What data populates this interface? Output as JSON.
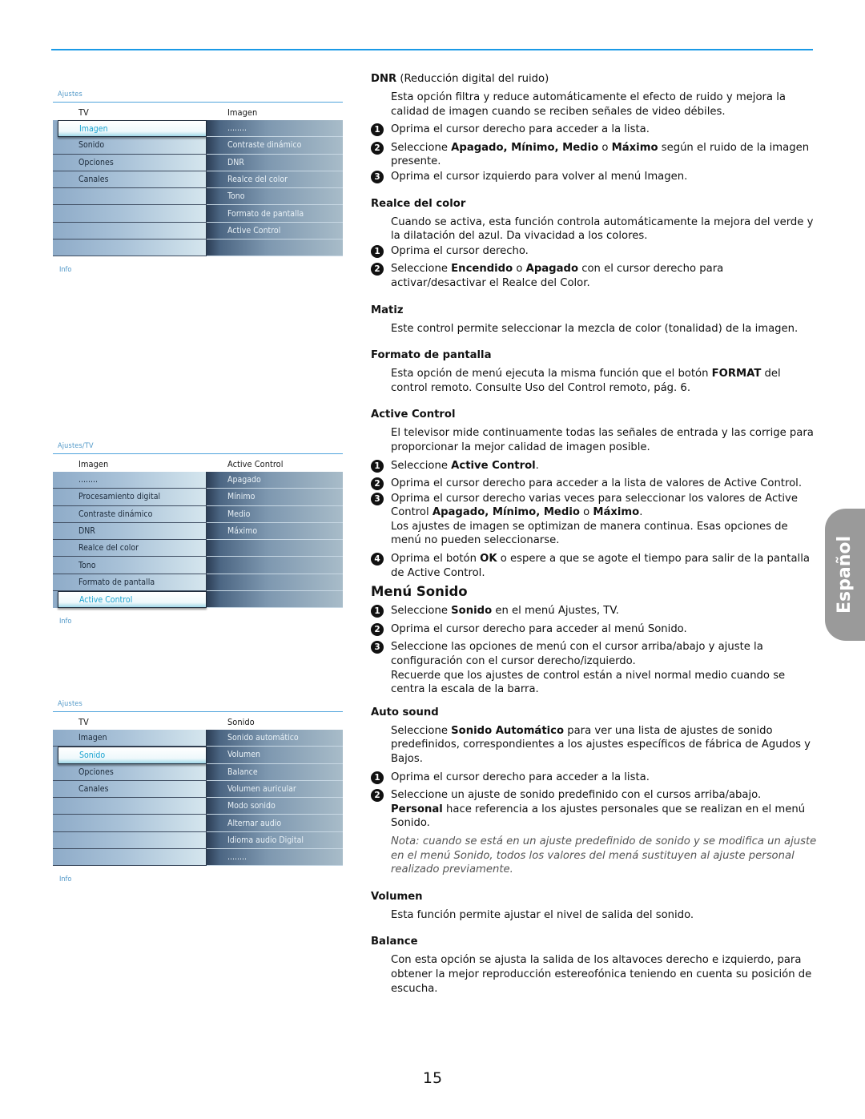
{
  "language_tab": "Español",
  "page_number": "15",
  "menus": [
    {
      "breadcrumb": "Ajustes",
      "left_header": "TV",
      "right_header": "Imagen",
      "left_items": [
        "Imagen",
        "Sonido",
        "Opciones",
        "Canales",
        "",
        "",
        "",
        ""
      ],
      "selected_index": 0,
      "right_items": [
        "........",
        "Contraste dinámico",
        "DNR",
        "Realce del color",
        "Tono",
        "Formato de pantalla",
        "Active Control",
        ""
      ],
      "info": "Info"
    },
    {
      "breadcrumb": "Ajustes/TV",
      "left_header": "Imagen",
      "right_header": "Active Control",
      "left_items": [
        "........",
        "Procesamiento digital",
        "Contraste dinámico",
        "DNR",
        "Realce del color",
        "Tono",
        "Formato de pantalla",
        "Active Control"
      ],
      "selected_index": 7,
      "right_items": [
        "Apagado",
        "Mínimo",
        "Medio",
        "Máximo",
        "",
        "",
        "",
        ""
      ],
      "info": "Info"
    },
    {
      "breadcrumb": "Ajustes",
      "left_header": "TV",
      "right_header": "Sonido",
      "left_items": [
        "Imagen",
        "Sonido",
        "Opciones",
        "Canales",
        "",
        "",
        "",
        ""
      ],
      "selected_index": 1,
      "right_items": [
        "Sonido automático",
        "Volumen",
        "Balance",
        "Volumen auricular",
        "Modo sonido",
        "Alternar audio",
        "Idioma audio Digital",
        "........"
      ],
      "info": "Info"
    }
  ],
  "sections": {
    "dnr": {
      "title": "DNR",
      "title_suffix": " (Reducción digital del ruido)",
      "body": "Esta opción filtra y reduce automáticamente el efecto de ruido y mejora la calidad de imagen cuando se reciben señales de video débiles.",
      "step1": "Oprima el cursor derecho para acceder a la lista.",
      "step2_a": "Seleccione ",
      "step2_b": "Apagado, Mínimo, Medio",
      "step2_c": " o ",
      "step2_d": "Máximo",
      "step2_e": " según el ruido de la imagen presente.",
      "step3": "Oprima el cursor izquierdo para volver al menú Imagen."
    },
    "realce": {
      "title": "Realce del color",
      "body": "Cuando se activa, esta función controla automáticamente la mejora del verde y la dilatación del azul.  Da vivacidad a los colores.",
      "step1": "Oprima el cursor derecho.",
      "step2_a": "Seleccione ",
      "step2_b": "Encendido",
      "step2_c": " o ",
      "step2_d": "Apagado",
      "step2_e": " con el cursor derecho para activar/desactivar el Realce del Color."
    },
    "matiz": {
      "title": "Matiz",
      "body": "Este control permite seleccionar la mezcla de color (tonalidad) de la imagen."
    },
    "formato": {
      "title": "Formato de pantalla",
      "body_a": "Esta opción de menú ejecuta la misma función que el botón ",
      "body_b": "FORMAT",
      "body_c": " del control remoto. Consulte Uso del Control remoto, pág. 6."
    },
    "active": {
      "title": "Active Control",
      "body": "El televisor mide continuamente todas las señales de entrada y las corrige para proporcionar la mejor calidad de imagen posible.",
      "step1_a": "Seleccione ",
      "step1_b": "Active Control",
      "step1_c": ".",
      "step2": "Oprima el cursor derecho para acceder a la lista de valores de Active Control.",
      "step3_a": "Oprima el cursor derecho varias veces para seleccionar los valores de Active Control ",
      "step3_b": "Apagado, Mínimo, Medio",
      "step3_c": " o ",
      "step3_d": "Máximo",
      "step3_e": ".",
      "step3_note": "Los ajustes de imagen se optimizan de manera continua. Esas opciones de menú no pueden seleccionarse.",
      "step4_a": "Oprima el botón ",
      "step4_b": "OK",
      "step4_c": " o espere a que se agote el tiempo para salir de la pantalla de Active Control."
    },
    "menu_sonido": {
      "title": "Menú Sonido",
      "step1_a": "Seleccione ",
      "step1_b": "Sonido",
      "step1_c": " en el menú Ajustes, TV.",
      "step2": "Oprima el cursor derecho para acceder al menú Sonido.",
      "step3": "Seleccione las opciones de menú con el cursor arriba/abajo y ajuste la configuración con el cursor derecho/izquierdo.",
      "step3_note": "Recuerde que los ajustes de control están a nivel normal medio cuando se centra la escala de la barra."
    },
    "auto_sound": {
      "title": "Auto sound",
      "body_a": "Seleccione ",
      "body_b": "Sonido Automático",
      "body_c": " para ver una lista de ajustes de sonido predefinidos, correspondientes a los ajustes específicos de fábrica de Agudos y Bajos.",
      "step1": "Oprima el cursor derecho para acceder a la lista.",
      "step2": "Seleccione un ajuste de sonido predefinido con el cursos arriba/abajo.",
      "step2_b": "Personal",
      "step2_c": " hace referencia a los ajustes personales que se realizan en el menú Sonido.",
      "note": "Nota: cuando se está en un ajuste predefinido de sonido y se modifica un ajuste en el menú Sonido, todos los valores del mená sustituyen al ajuste personal realizado previamente."
    },
    "volumen": {
      "title": "Volumen",
      "body": "Esta función permite ajustar el nivel de salida del sonido."
    },
    "balance": {
      "title": "Balance",
      "body": "Con esta opción se ajusta la salida de los altavoces derecho e izquierdo, para obtener la mejor reproducción estereofónica teniendo en cuenta su posición de escucha."
    }
  },
  "step_numbers": [
    "1",
    "2",
    "3",
    "4"
  ]
}
